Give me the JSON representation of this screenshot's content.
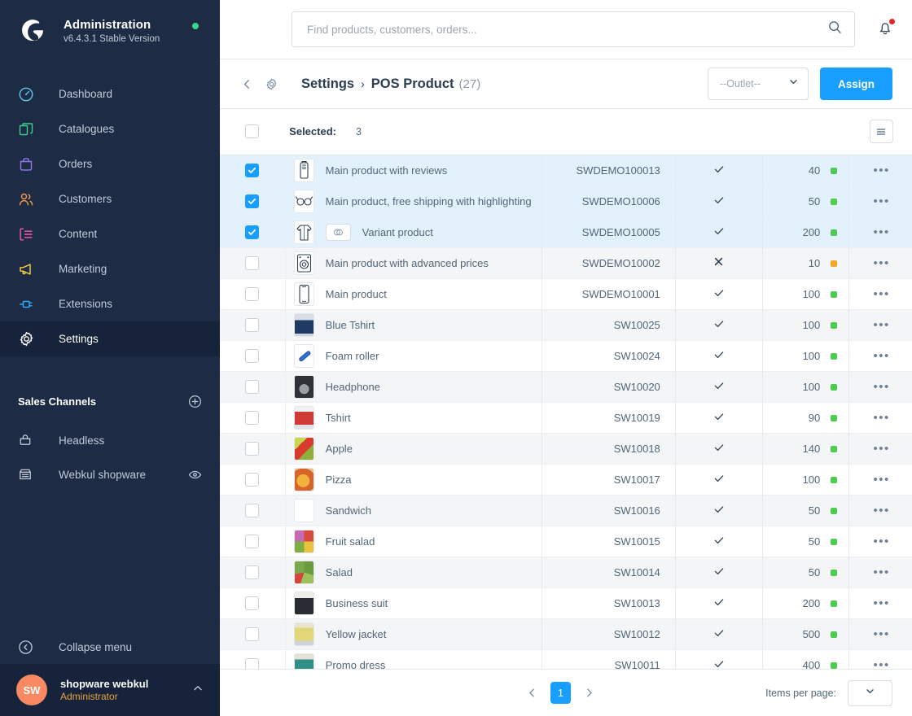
{
  "sidebar": {
    "brand": {
      "title": "Administration",
      "version": "v6.4.3.1 Stable Version"
    },
    "nav": [
      {
        "label": "Dashboard",
        "icon": "dashboard-icon",
        "color": "#60c6eb",
        "active": false
      },
      {
        "label": "Catalogues",
        "icon": "catalogues-icon",
        "color": "#3ecf8e",
        "active": false
      },
      {
        "label": "Orders",
        "icon": "orders-icon",
        "color": "#8d7ae8",
        "active": false
      },
      {
        "label": "Customers",
        "icon": "customers-icon",
        "color": "#f2994a",
        "active": false
      },
      {
        "label": "Content",
        "icon": "content-icon",
        "color": "#f45bb5",
        "active": false
      },
      {
        "label": "Marketing",
        "icon": "marketing-icon",
        "color": "#f5d145",
        "active": false
      },
      {
        "label": "Extensions",
        "icon": "extensions-icon",
        "color": "#33aaff",
        "active": false
      },
      {
        "label": "Settings",
        "icon": "gear-icon",
        "color": "#ffffff",
        "active": true
      }
    ],
    "sales_channels": {
      "title": "Sales Channels",
      "add_icon": "plus-circle-icon",
      "items": [
        {
          "label": "Headless",
          "icon": "headless-icon",
          "has_eye": false
        },
        {
          "label": "Webkul shopware",
          "icon": "storefront-icon",
          "has_eye": true
        }
      ]
    },
    "collapse": {
      "label": "Collapse menu",
      "icon": "chevron-left-circle-icon"
    },
    "user": {
      "initials": "SW",
      "name": "shopware webkul",
      "role": "Administrator",
      "caret": "chevron-up-icon"
    }
  },
  "topbar": {
    "search": {
      "placeholder": "Find products, customers, orders...",
      "value": "",
      "icon": "search-icon"
    },
    "notifications": {
      "icon": "bell-icon",
      "has_unread": true
    }
  },
  "subheader": {
    "back_icon": "chevron-left-icon",
    "module_icon": "gear-icon",
    "breadcrumb_root": "Settings",
    "breadcrumb_separator": "›",
    "breadcrumb_current": "POS Product",
    "count": "(27)",
    "outlet_select": {
      "label": "--Outlet--",
      "caret": "chevron-down-icon"
    },
    "assign_button": "Assign"
  },
  "table": {
    "selected_label": "Selected:",
    "selected_count": "3",
    "settings_icon": "table-settings-icon",
    "rows": [
      {
        "checked": true,
        "name": "Main product with reviews",
        "variant": false,
        "sku": "SWDEMO100013",
        "active": true,
        "stock": "40",
        "stock_status": "#4ecb51",
        "thumb": "phone-case",
        "menu": "•••"
      },
      {
        "checked": true,
        "name": "Main product, free shipping with highlighting",
        "variant": false,
        "sku": "SWDEMO10006",
        "active": true,
        "stock": "50",
        "stock_status": "#4ecb51",
        "thumb": "glasses",
        "menu": "•••"
      },
      {
        "checked": true,
        "name": "Variant product",
        "variant": true,
        "sku": "SWDEMO10005",
        "active": true,
        "stock": "200",
        "stock_status": "#4ecb51",
        "thumb": "sweater",
        "menu": "•••"
      },
      {
        "checked": false,
        "name": "Main product with advanced prices",
        "variant": false,
        "sku": "SWDEMO10002",
        "active": false,
        "stock": "10",
        "stock_status": "#f5a623",
        "thumb": "washer",
        "menu": "•••"
      },
      {
        "checked": false,
        "name": "Main product",
        "variant": false,
        "sku": "SWDEMO10001",
        "active": true,
        "stock": "100",
        "stock_status": "#4ecb51",
        "thumb": "phone",
        "menu": "•••"
      },
      {
        "checked": false,
        "name": "Blue Tshirt",
        "variant": false,
        "sku": "SW10025",
        "active": true,
        "stock": "100",
        "stock_status": "#4ecb51",
        "thumb": "blue-shirt",
        "menu": "•••"
      },
      {
        "checked": false,
        "name": "Foam roller",
        "variant": false,
        "sku": "SW10024",
        "active": true,
        "stock": "100",
        "stock_status": "#4ecb51",
        "thumb": "roller",
        "menu": "•••"
      },
      {
        "checked": false,
        "name": "Headphone",
        "variant": false,
        "sku": "SW10020",
        "active": true,
        "stock": "100",
        "stock_status": "#4ecb51",
        "thumb": "headphone",
        "menu": "•••"
      },
      {
        "checked": false,
        "name": "Tshirt",
        "variant": false,
        "sku": "SW10019",
        "active": true,
        "stock": "90",
        "stock_status": "#4ecb51",
        "thumb": "red-shirt",
        "menu": "•••"
      },
      {
        "checked": false,
        "name": "Apple",
        "variant": false,
        "sku": "SW10018",
        "active": true,
        "stock": "140",
        "stock_status": "#4ecb51",
        "thumb": "apple",
        "menu": "•••"
      },
      {
        "checked": false,
        "name": "Pizza",
        "variant": false,
        "sku": "SW10017",
        "active": true,
        "stock": "100",
        "stock_status": "#4ecb51",
        "thumb": "pizza",
        "menu": "•••"
      },
      {
        "checked": false,
        "name": "Sandwich",
        "variant": false,
        "sku": "SW10016",
        "active": true,
        "stock": "50",
        "stock_status": "#4ecb51",
        "thumb": "sandwich",
        "menu": "•••"
      },
      {
        "checked": false,
        "name": "Fruit salad",
        "variant": false,
        "sku": "SW10015",
        "active": true,
        "stock": "50",
        "stock_status": "#4ecb51",
        "thumb": "fruitsalad",
        "menu": "•••"
      },
      {
        "checked": false,
        "name": "Salad",
        "variant": false,
        "sku": "SW10014",
        "active": true,
        "stock": "50",
        "stock_status": "#4ecb51",
        "thumb": "salad",
        "menu": "•••"
      },
      {
        "checked": false,
        "name": "Business suit",
        "variant": false,
        "sku": "SW10013",
        "active": true,
        "stock": "200",
        "stock_status": "#4ecb51",
        "thumb": "suit",
        "menu": "•••"
      },
      {
        "checked": false,
        "name": "Yellow jacket",
        "variant": false,
        "sku": "SW10012",
        "active": true,
        "stock": "500",
        "stock_status": "#4ecb51",
        "thumb": "jacket",
        "menu": "•••"
      },
      {
        "checked": false,
        "name": "Promo dress",
        "variant": false,
        "sku": "SW10011",
        "active": true,
        "stock": "400",
        "stock_status": "#4ecb51",
        "thumb": "dress",
        "menu": "•••"
      }
    ]
  },
  "pagination": {
    "prev_icon": "chevron-left-icon",
    "next_icon": "chevron-right-icon",
    "current_page": "1",
    "items_per_page_label": "Items per page:",
    "items_per_page_value": "",
    "caret": "chevron-down-icon"
  },
  "colors": {
    "sidebar_bg": "#1d2b44",
    "sidebar_active": "#16233b",
    "accent_blue": "#189eff",
    "row_selected": "#e3f1fd",
    "row_alt": "#f4f5f7",
    "status_green": "#4ecb51",
    "status_orange": "#f5a623",
    "avatar": "#f88962",
    "role_text": "#e8a33d"
  }
}
